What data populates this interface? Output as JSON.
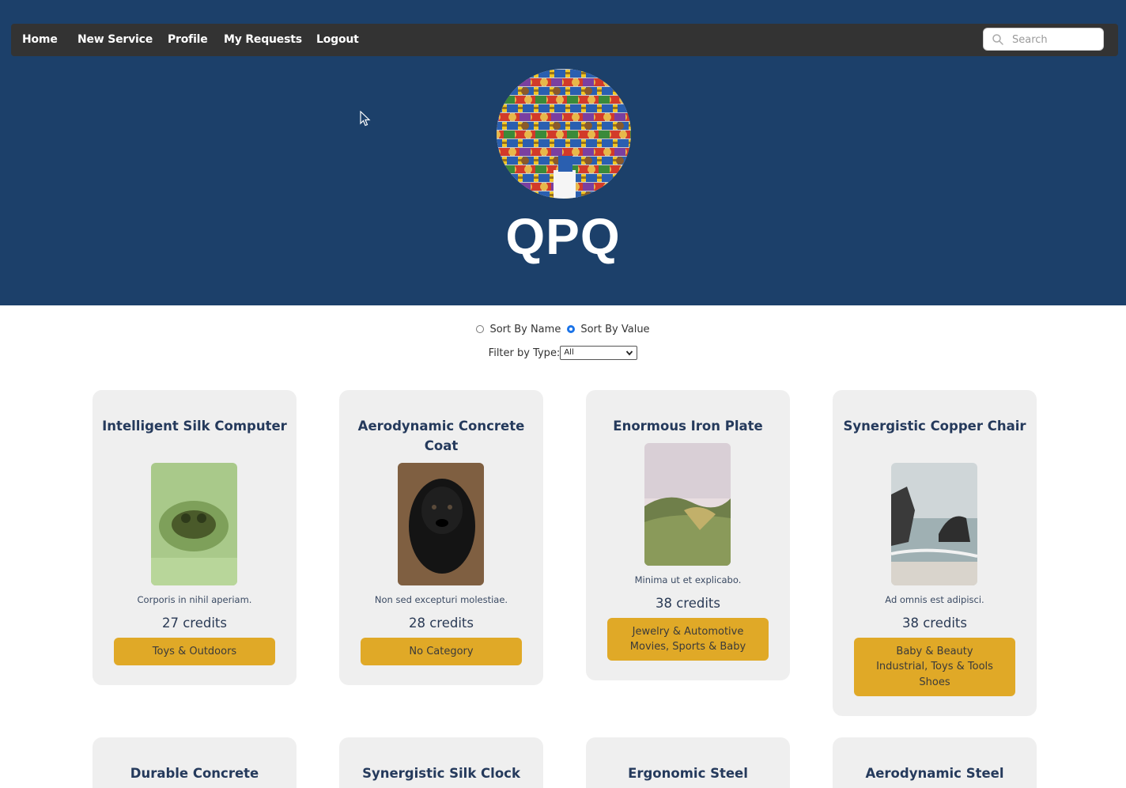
{
  "nav": {
    "links": [
      "Home",
      "New Service",
      "Profile",
      "My Requests",
      "Logout"
    ],
    "search_placeholder": "Search"
  },
  "site": {
    "title": "QPQ"
  },
  "controls": {
    "sort_by_name": "Sort By Name",
    "sort_by_value": "Sort By Value",
    "sort_selected": "value",
    "filter_label": "Filter by Type:",
    "filter_value": "All"
  },
  "cards": [
    {
      "title": "Intelligent Silk Computer",
      "description": "Corporis in nihil aperiam.",
      "credits": "27 credits",
      "categories": [
        "Toys & Outdoors"
      ]
    },
    {
      "title": "Aerodynamic Concrete Coat",
      "description": "Non sed excepturi molestiae.",
      "credits": "28 credits",
      "categories": [
        "No Category"
      ]
    },
    {
      "title": "Enormous Iron Plate",
      "description": "Minima ut et explicabo.",
      "credits": "38 credits",
      "categories": [
        "Jewelry & Automotive",
        "Movies, Sports & Baby"
      ]
    },
    {
      "title": "Synergistic Copper Chair",
      "description": "Ad omnis est adipisci.",
      "credits": "38 credits",
      "categories": [
        "Baby & Beauty",
        "Industrial, Toys & Tools",
        "Shoes"
      ]
    },
    {
      "title": "Durable Concrete"
    },
    {
      "title": "Synergistic Silk Clock"
    },
    {
      "title": "Ergonomic Steel"
    },
    {
      "title": "Aerodynamic Steel"
    }
  ],
  "colors": {
    "hero": "#1c406a",
    "navbar": "#333333",
    "card": "#efefef",
    "category": "#e0a927"
  },
  "icons": {
    "search": "search-icon",
    "cursor": "mouse-cursor-icon",
    "select": "chevron-down-icon"
  }
}
